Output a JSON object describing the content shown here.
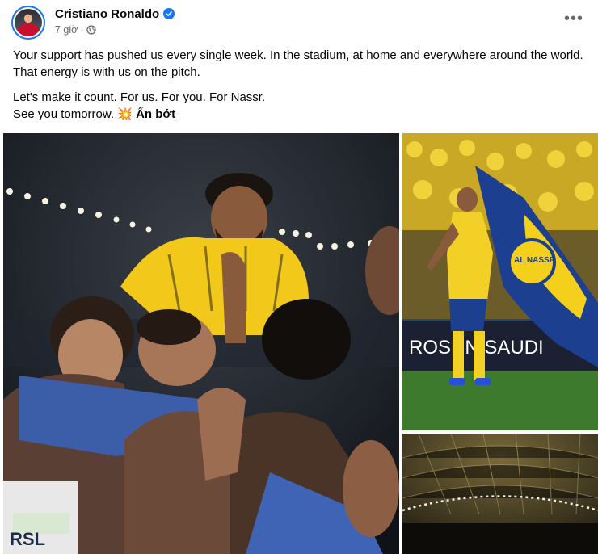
{
  "post": {
    "author": "Cristiano Ronaldo",
    "time": "7 giờ",
    "privacy_icon": "globe-icon",
    "more_icon": "more-horizontal-icon",
    "caption": {
      "line1": "Your support has pushed us every single week. In the stadium, at home and everywhere around the world. That energy is with us on the pitch.",
      "line2": "Let's make it count. For us. For you. For Nassr.",
      "line3": "See you tomorrow.",
      "emoji": "💥",
      "see_less": "Ẩn bớt"
    },
    "media": {
      "main": {
        "badge": "RSL"
      },
      "right_top": {
        "banner": "ROSHN SAUDI",
        "flag_text": "AL NASSR"
      }
    },
    "colors": {
      "verified": "#1877f2",
      "meta": "#65676b",
      "accent_yellow": "#f4d01c",
      "al_nassr_blue": "#1d3f8f"
    }
  }
}
